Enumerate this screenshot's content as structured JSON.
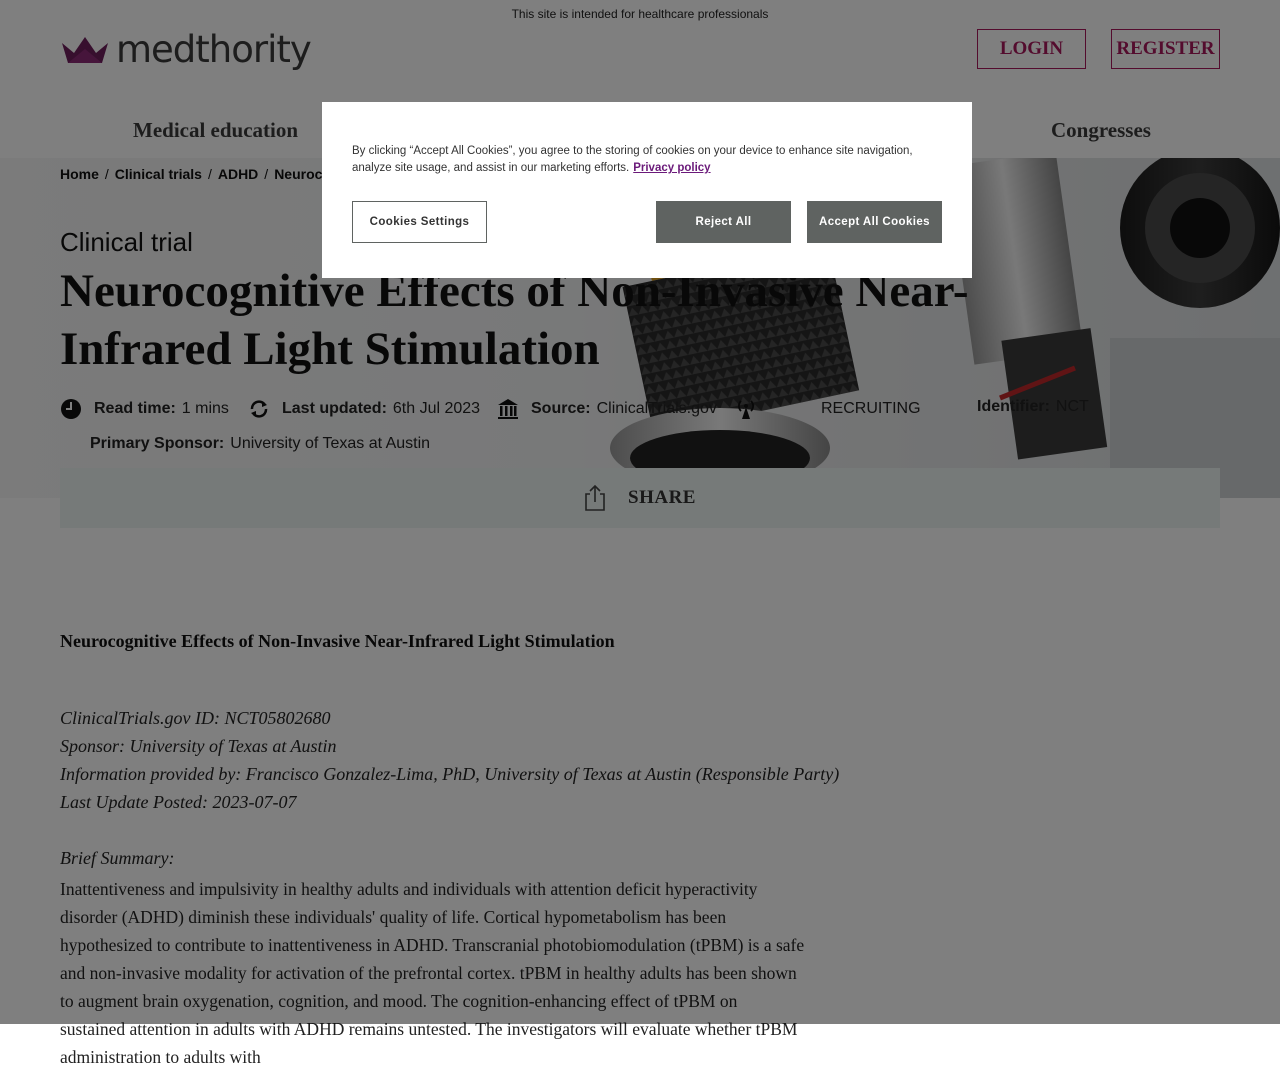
{
  "header": {
    "notice": "This site is intended for healthcare professionals",
    "logo_text": "medthority",
    "login_label": "LOGIN",
    "register_label": "REGISTER"
  },
  "nav": {
    "items": [
      "Medical education",
      "Congresses"
    ]
  },
  "breadcrumb": [
    "Home",
    "Clinical trials",
    "ADHD",
    "Neurocog"
  ],
  "hero": {
    "kicker": "Clinical trial",
    "title": "Neurocognitive Effects of Non-Invasive Near-Infrared Light Stimulation",
    "meta": {
      "read_time_label": "Read time:",
      "read_time_value": "1 mins",
      "updated_label": "Last updated:",
      "updated_value": "6th Jul 2023",
      "source_label": "Source:",
      "source_value": "ClinicalTrials.gov",
      "status_value": "RECRUITING",
      "identifier_label": "Identifier:",
      "identifier_value": "NCT",
      "sponsor_label": "Primary Sponsor:",
      "sponsor_value": "University of Texas at Austin"
    }
  },
  "share_label": "SHARE",
  "article": {
    "title": "Neurocognitive Effects of Non-Invasive Near-Infrared Light Stimulation",
    "info": [
      "ClinicalTrials.gov ID: NCT05802680",
      "Sponsor: University of Texas at Austin",
      "Information provided by: Francisco Gonzalez-Lima, PhD, University of Texas at Austin (Responsible Party)",
      "Last Update Posted: 2023-07-07"
    ],
    "summary_label": "Brief Summary:",
    "summary": "Inattentiveness and impulsivity in healthy adults and individuals with attention deficit hyperactivity disorder (ADHD) diminish these individuals' quality of life. Cortical hypometabolism has been hypothesized to contribute to inattentiveness in ADHD. Transcranial photobiomodulation (tPBM) is a safe and non-invasive modality for activation of the prefrontal cortex. tPBM in healthy adults has been shown to augment brain oxygenation, cognition, and mood. The cognition-enhancing effect of tPBM on sustained attention in adults with ADHD remains untested. The investigators will evaluate whether tPBM administration to adults with"
  },
  "cookie_modal": {
    "text": "By clicking “Accept All Cookies”, you agree to the storing of cookies on your device to enhance site navigation, analyze site usage, and assist in our marketing efforts.",
    "privacy_link": "Privacy policy",
    "settings_label": "Cookies Settings",
    "reject_label": "Reject All",
    "accept_label": "Accept All Cookies"
  },
  "colors": {
    "brand": "#a8195c",
    "share_bar": "#edf4f2",
    "modal_button": "#5f6361"
  }
}
